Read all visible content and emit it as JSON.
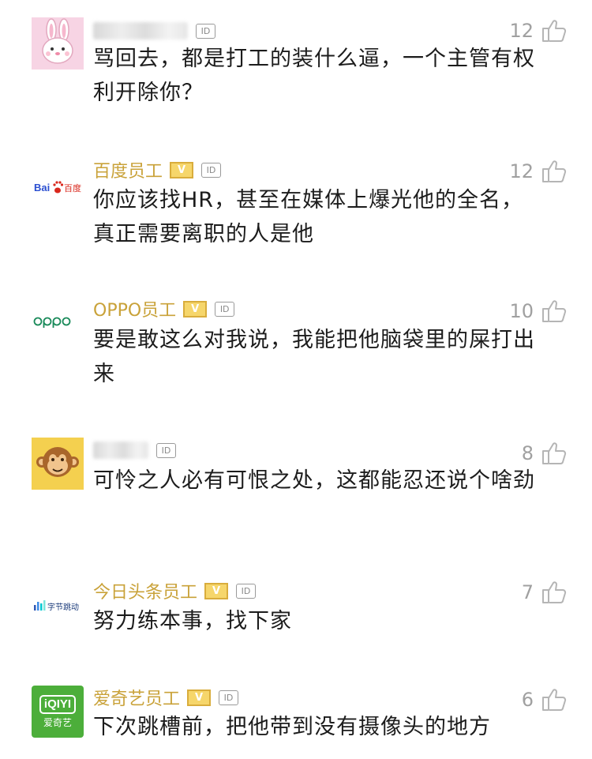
{
  "comments": [
    {
      "name": "",
      "name_blurred": true,
      "verified": false,
      "id_label": "ID",
      "likes": "12",
      "text": "骂回去，都是打工的装什么逼，一个主管有权利开除你？",
      "avatar_icon": "rabbit-avatar-icon"
    },
    {
      "name": "百度员工",
      "name_blurred": false,
      "verified": true,
      "verified_label": "V",
      "id_label": "ID",
      "likes": "12",
      "text": "你应该找HR，甚至在媒体上爆光他的全名，真正需要离职的人是他",
      "avatar_icon": "baidu-logo-icon",
      "avatar_text": "Bai百度"
    },
    {
      "name": "OPPO员工",
      "name_blurred": false,
      "verified": true,
      "verified_label": "V",
      "id_label": "ID",
      "likes": "10",
      "text": "要是敢这么对我说，我能把他脑袋里的屎打出来",
      "avatar_icon": "oppo-logo-icon",
      "avatar_text": "oppo"
    },
    {
      "name": "",
      "name_blurred": true,
      "verified": false,
      "id_label": "ID",
      "likes": "8",
      "text": "可怜之人必有可恨之处，这都能忍还说个啥劲",
      "avatar_icon": "monkey-avatar-icon"
    },
    {
      "name": "今日头条员工",
      "name_blurred": false,
      "verified": true,
      "verified_label": "V",
      "id_label": "ID",
      "likes": "7",
      "text": "努力练本事，找下家",
      "avatar_icon": "bytedance-logo-icon",
      "avatar_text": "字节跳动"
    },
    {
      "name": "爱奇艺员工",
      "name_blurred": false,
      "verified": true,
      "verified_label": "V",
      "id_label": "ID",
      "likes": "6",
      "text": "下次跳槽前，把他带到没有摄像头的地方",
      "avatar_icon": "iqiyi-logo-icon",
      "avatar_text": "爱奇艺",
      "avatar_logo_text": "iQIYI"
    }
  ],
  "colors": {
    "name": "#c9a239",
    "text": "#1c1c1c",
    "likes": "#a0a0a0",
    "iqiyi_green": "#4cae3a",
    "monkey_bg": "#f4d04f",
    "rabbit_bg": "#f7d4e4"
  }
}
